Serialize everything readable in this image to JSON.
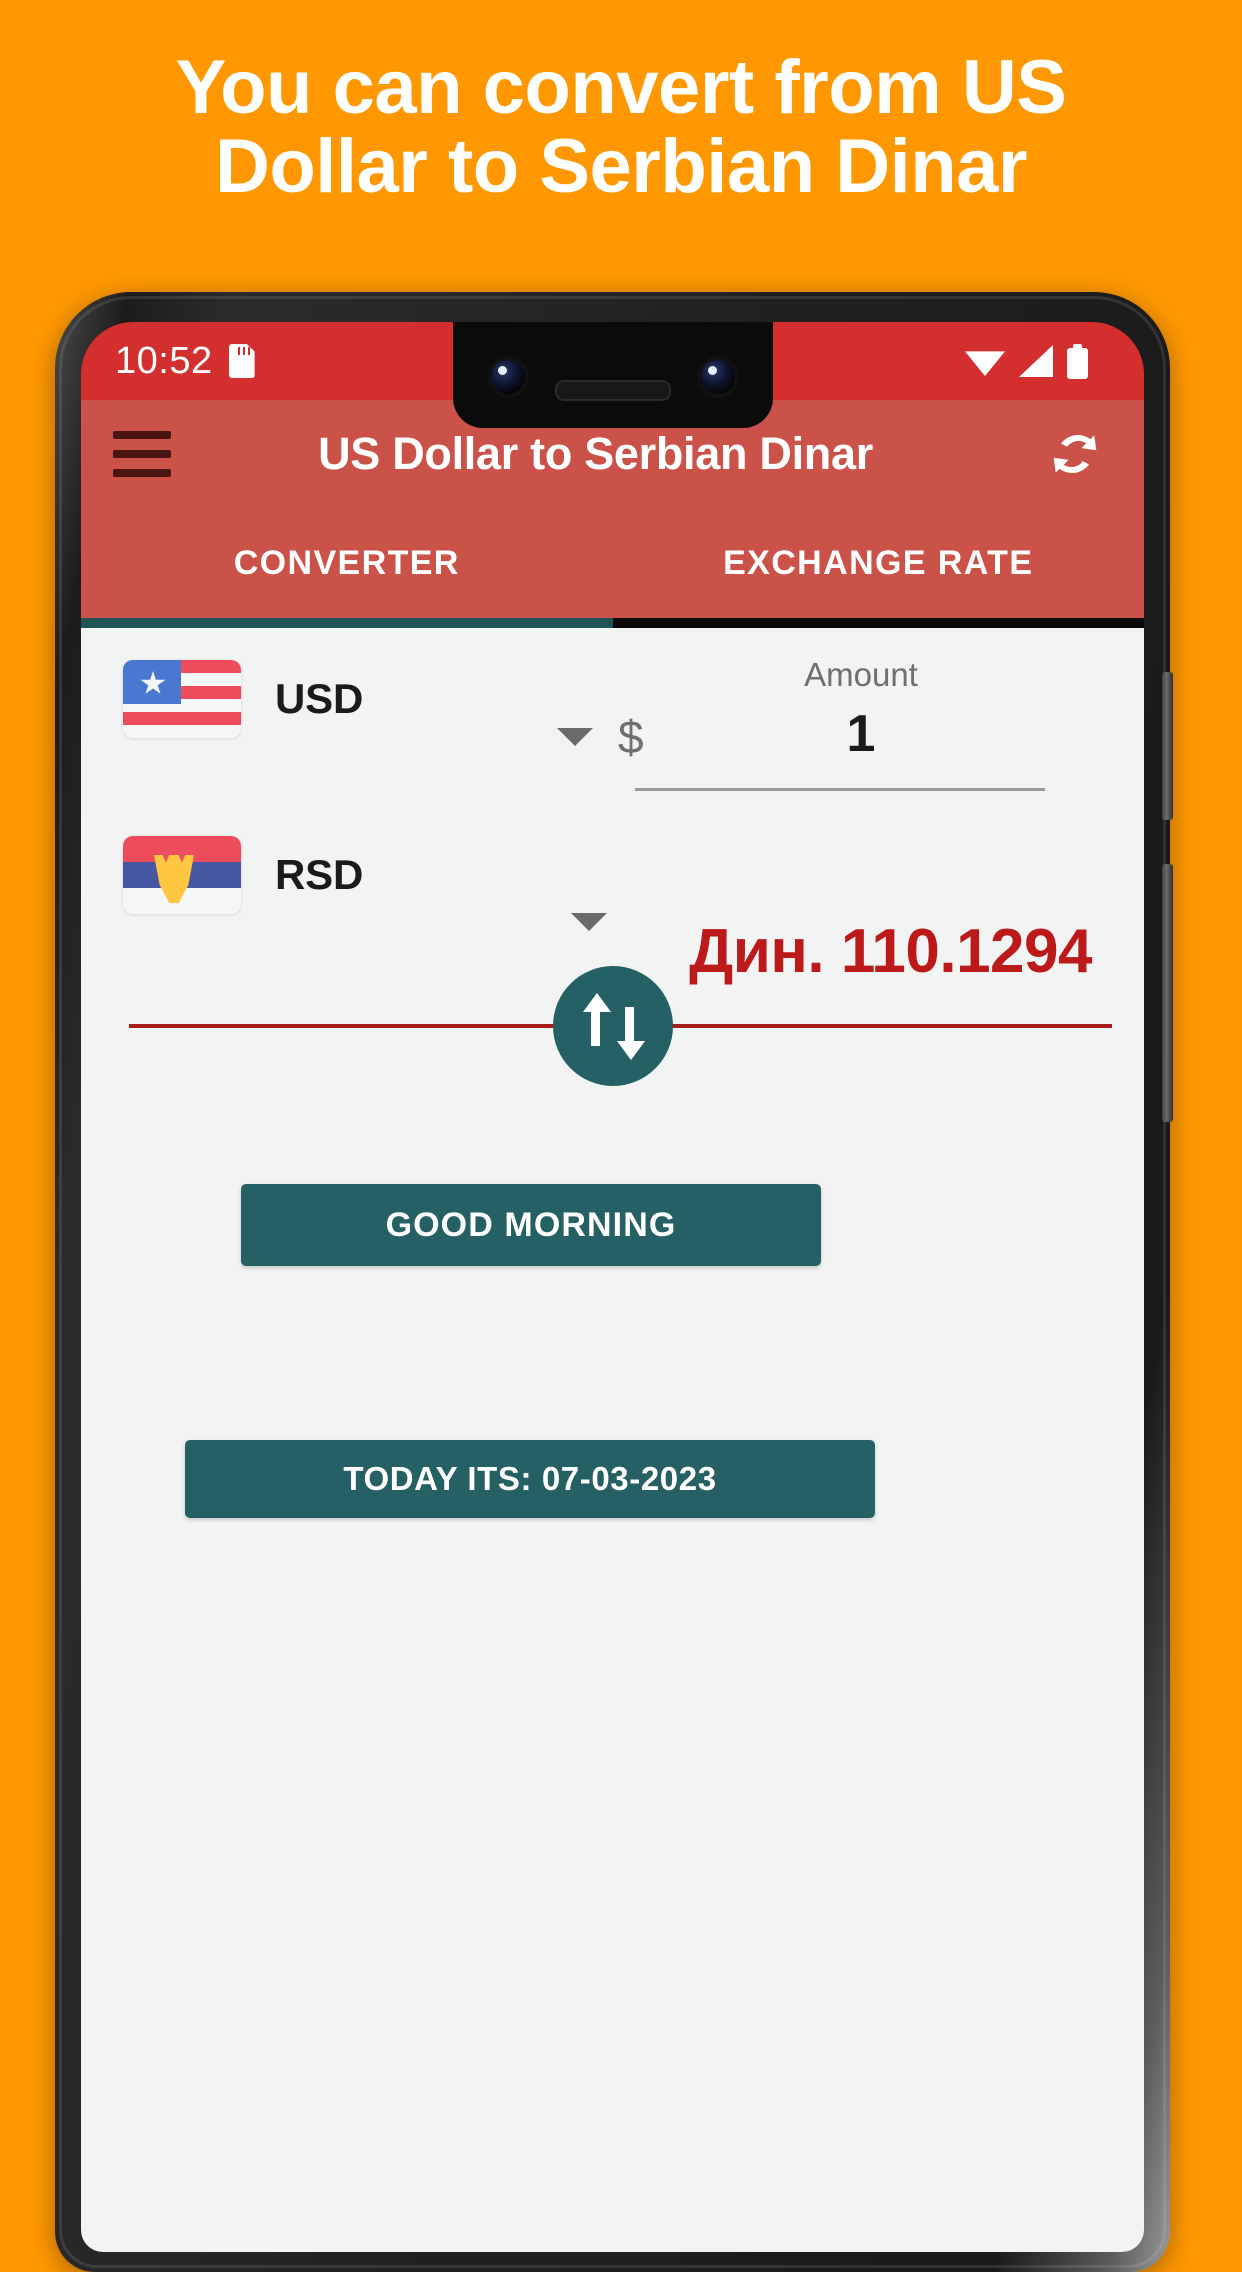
{
  "promo": {
    "headline": "You can convert from US Dollar to Serbian Dinar",
    "background_color": "#FF9800",
    "text_color": "#FFFFFF"
  },
  "status_bar": {
    "time": "10:52",
    "icons": [
      "sd-card-icon",
      "wifi-icon",
      "signal-icon",
      "battery-icon"
    ],
    "background_color": "#D32F2F"
  },
  "app_bar": {
    "menu_icon": "hamburger-menu-icon",
    "title": "US Dollar to Serbian Dinar",
    "action_icon": "refresh-icon",
    "background_color": "#CB5248"
  },
  "tabs": {
    "items": [
      {
        "label": "CONVERTER",
        "selected": true
      },
      {
        "label": "EXCHANGE RATE",
        "selected": false
      }
    ],
    "indicator_color": "#1F5457"
  },
  "converter": {
    "from": {
      "flag": "flag-united-states",
      "code": "USD",
      "symbol": "$",
      "amount_label": "Amount",
      "amount_value": "1",
      "dropdown_icon": "chevron-down-icon"
    },
    "to": {
      "flag": "flag-serbia",
      "code": "RSD",
      "result": "Дин. 110.1294",
      "result_color": "#BC1A1A",
      "dropdown_icon": "chevron-down-icon"
    },
    "swap": {
      "icon": "swap-vertical-arrows-icon",
      "color": "#256064"
    },
    "divider_color": "#A81B1B"
  },
  "actions": {
    "greeting_button": "GOOD MORNING",
    "date_button": "TODAY ITS: 07-03-2023",
    "button_color": "#256064"
  }
}
